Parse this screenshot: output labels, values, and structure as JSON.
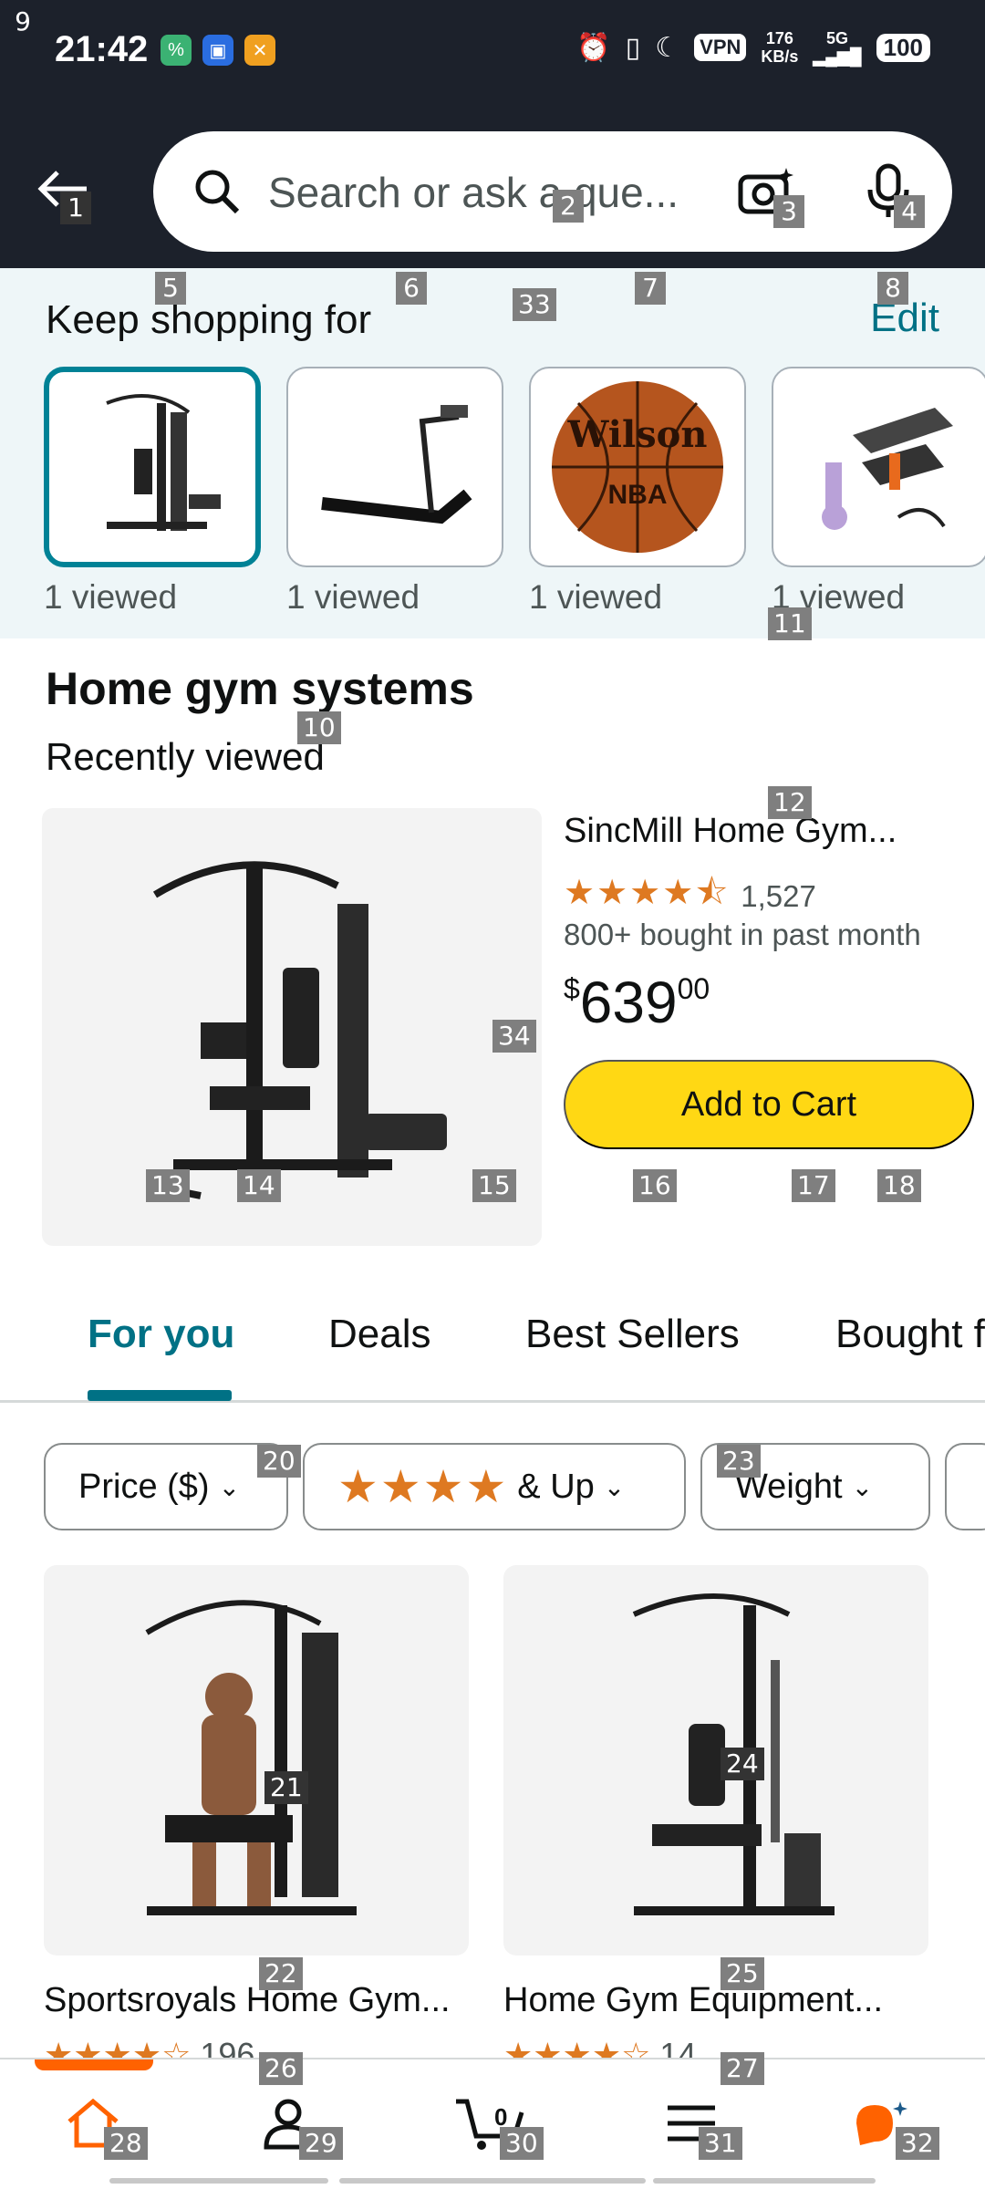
{
  "status_bar": {
    "time": "21:42",
    "vpn": "VPN",
    "speed_value": "176",
    "speed_unit": "KB/s",
    "network": "5G",
    "battery": "100"
  },
  "header": {
    "search_placeholder": "Search or ask a que..."
  },
  "keep_shopping": {
    "title": "Keep shopping for",
    "edit_label": "Edit",
    "items": [
      {
        "icon": "home-gym-image",
        "label": "1 viewed"
      },
      {
        "icon": "treadmill-image",
        "label": "1 viewed"
      },
      {
        "icon": "basketball-image",
        "label": "1 viewed"
      },
      {
        "icon": "stepper-image",
        "label": "1 viewed"
      }
    ],
    "basketball_brand": "Wilson",
    "basketball_league": "NBA"
  },
  "home_gym": {
    "title": "Home gym systems",
    "subtitle": "Recently viewed",
    "product": {
      "name": "SincMill Home Gym...",
      "stars": "★★★★⯪",
      "rating_count": "1,527",
      "bought": "800+ bought in past month",
      "price_symbol": "$",
      "price_whole": "639",
      "price_cents": "00",
      "add_to_cart": "Add to Cart"
    }
  },
  "tabs": [
    {
      "label": "For you",
      "active": true
    },
    {
      "label": "Deals",
      "active": false
    },
    {
      "label": "Best Sellers",
      "active": false
    },
    {
      "label": "Bought f",
      "active": false
    }
  ],
  "filters": {
    "price": "Price ($)",
    "rating_stars": "★★★★",
    "rating_suffix": "& Up",
    "weight": "Weight"
  },
  "grid_products": [
    {
      "name": "Sportsroyals Home Gym...",
      "stars": "★★★★☆",
      "count": "196"
    },
    {
      "name": "Home Gym Equipment...",
      "stars": "★★★★☆",
      "count": "14"
    }
  ],
  "overlay_labels": [
    "9",
    "1",
    "2",
    "3",
    "4",
    "5",
    "6",
    "33",
    "7",
    "8",
    "11",
    "10",
    "12",
    "34",
    "13",
    "14",
    "15",
    "16",
    "17",
    "18",
    "20",
    "23",
    "21",
    "24",
    "22",
    "25",
    "26",
    "27",
    "28",
    "29",
    "30",
    "31",
    "32"
  ],
  "colors": {
    "header_bg": "#1c212b",
    "accent_teal": "#007185",
    "add_to_cart": "#ffd814",
    "star_orange": "#de7921",
    "nav_orange": "#ff6200"
  }
}
